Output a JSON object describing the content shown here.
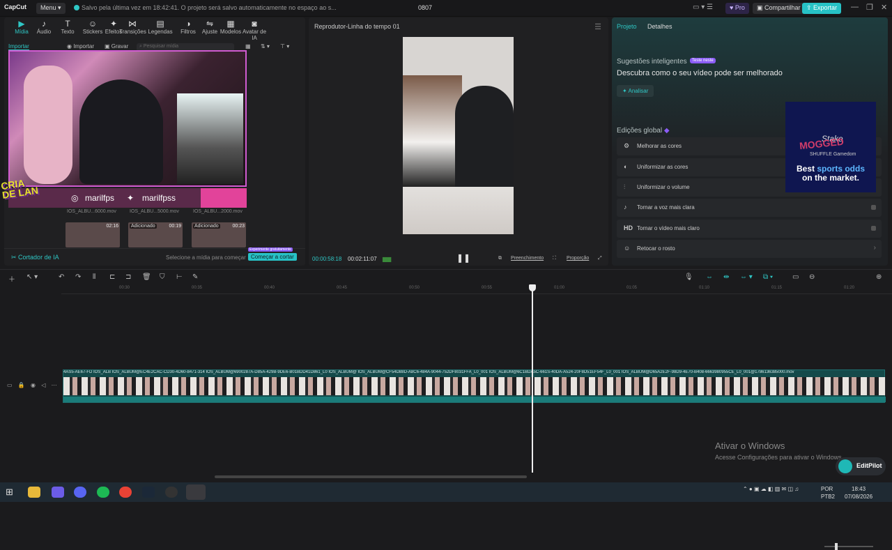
{
  "titlebar": {
    "app_name": "CapCut",
    "menu_label": "Menu",
    "save_status": "Salvo pela última vez em 18:42:41. O projeto será salvo automaticamente no espaço ao s...",
    "project_name": "0807",
    "pro_label": "Pro",
    "share_label": "Compartilhar",
    "export_label": "Exportar"
  },
  "left": {
    "tabs": [
      {
        "label": "Mídia",
        "icon": "media-icon"
      },
      {
        "label": "Áudio",
        "icon": "audio-icon"
      },
      {
        "label": "Texto",
        "icon": "text-icon"
      },
      {
        "label": "Stickers",
        "icon": "sticker-icon"
      },
      {
        "label": "Efeitos",
        "icon": "effects-icon"
      },
      {
        "label": "Transições",
        "icon": "transition-icon"
      },
      {
        "label": "Legendas",
        "icon": "captions-icon"
      },
      {
        "label": "Filtros",
        "icon": "filter-icon"
      },
      {
        "label": "Ajuste",
        "icon": "adjust-icon"
      },
      {
        "label": "Modelos",
        "icon": "templates-icon"
      },
      {
        "label": "Avatar de IA",
        "icon": "avatar-icon"
      }
    ],
    "import_label": "Importar",
    "import2_label": "Importar",
    "record_label": "Gravar",
    "search_placeholder": "Pesquisar mídia",
    "thumbs": [
      {
        "name": "IOS_ALBU...6000.mov",
        "tag": "",
        "dur": "02:16"
      },
      {
        "name": "IOS_ALBU...5000.mov",
        "tag": "Adicionado",
        "dur": "00:19"
      },
      {
        "name": "IOS_ALBU...2000.mov",
        "tag": "Adicionado",
        "dur": "00:23"
      }
    ],
    "cortador_label": "Cortador de IA",
    "select_hint": "Selecione a mídia para começar",
    "try_badge": "Experimente gratuitamente",
    "start_cut": "Começar a cortar"
  },
  "overlay": {
    "insta_handle": "marilfps",
    "twitter_handle": "marilfpss",
    "logo_line1": "CRIA",
    "logo_line2": "DE LAN"
  },
  "player": {
    "title": "Reprodutor-Linha do tempo 01",
    "current_time": "00:00:58:18",
    "total_time": "00:02:11:07",
    "fill_label": "Preenchimento",
    "ratio_label": "Proporção"
  },
  "right": {
    "tab_project": "Projeto",
    "tab_details": "Detalhes",
    "smart_title": "Sugestões inteligentes",
    "smart_badge": "Teste neste",
    "smart_desc": "Descubra como o seu vídeo pode ser melhorado",
    "analyze_label": "Analisar",
    "global_title": "Edições global",
    "options": [
      {
        "icon": "color-icon",
        "label": "Melhorar as cores"
      },
      {
        "icon": "color-match-icon",
        "label": "Uniformizar as cores"
      },
      {
        "icon": "volume-icon",
        "label": "Uniformizar o volume"
      },
      {
        "icon": "voice-icon",
        "label": "Tornar a voz mais clara"
      },
      {
        "icon": "hd-icon",
        "label": "Tornar o vídeo mais claro"
      },
      {
        "icon": "face-icon",
        "label": "Retocar o rosto"
      }
    ],
    "hd_text": "HD"
  },
  "ad": {
    "stake": "Stake",
    "mogged": "MOGGED",
    "sponsors": "SHUFFLE   Gamedom",
    "line1_a": "Best ",
    "line1_b": "sports odds",
    "line2": "on the market."
  },
  "timeline": {
    "ruler": [
      "00:30",
      "00:35",
      "00:40",
      "00:45",
      "00:50",
      "00:55",
      "01:00",
      "01:05",
      "01:10",
      "01:15",
      "01:20"
    ],
    "clip_labels": "4AS5-AE67-FD  IOS_ALB  IOS_ALBUM@EC4E2CAC-CD30-4D60-8471-314  IOS_ALBUM@6900287A-D85A-429B-9DE6-B01BDD41D861_L0  IOS_ALBUM@  IOS_ALBUM@CF54D88D-A8C6-484A-9044-752DF8031FFA_L0_001  IOS_ALBUM@6C1BDA5C-661S-40DA-A524-20F8D51EF54F_L0_001  IOS_ALBUM@D65A2E2F-98D9-4E70-B408-6663980955CE_L0_001@17861363850​00.mov"
  },
  "watermark": {
    "line1": "Ativar o Windows",
    "line2": "Acesse Configurações para ativar o Windows."
  },
  "editpilot_label": "EditPilot",
  "taskbar": {
    "lang1": "POR",
    "lang2": "PTB2",
    "time": "18:43",
    "date": "07/08/2026"
  },
  "colors": {
    "accent": "#27c2c6",
    "pro": "#8b5cf6",
    "bg": "#1b1b1d"
  }
}
